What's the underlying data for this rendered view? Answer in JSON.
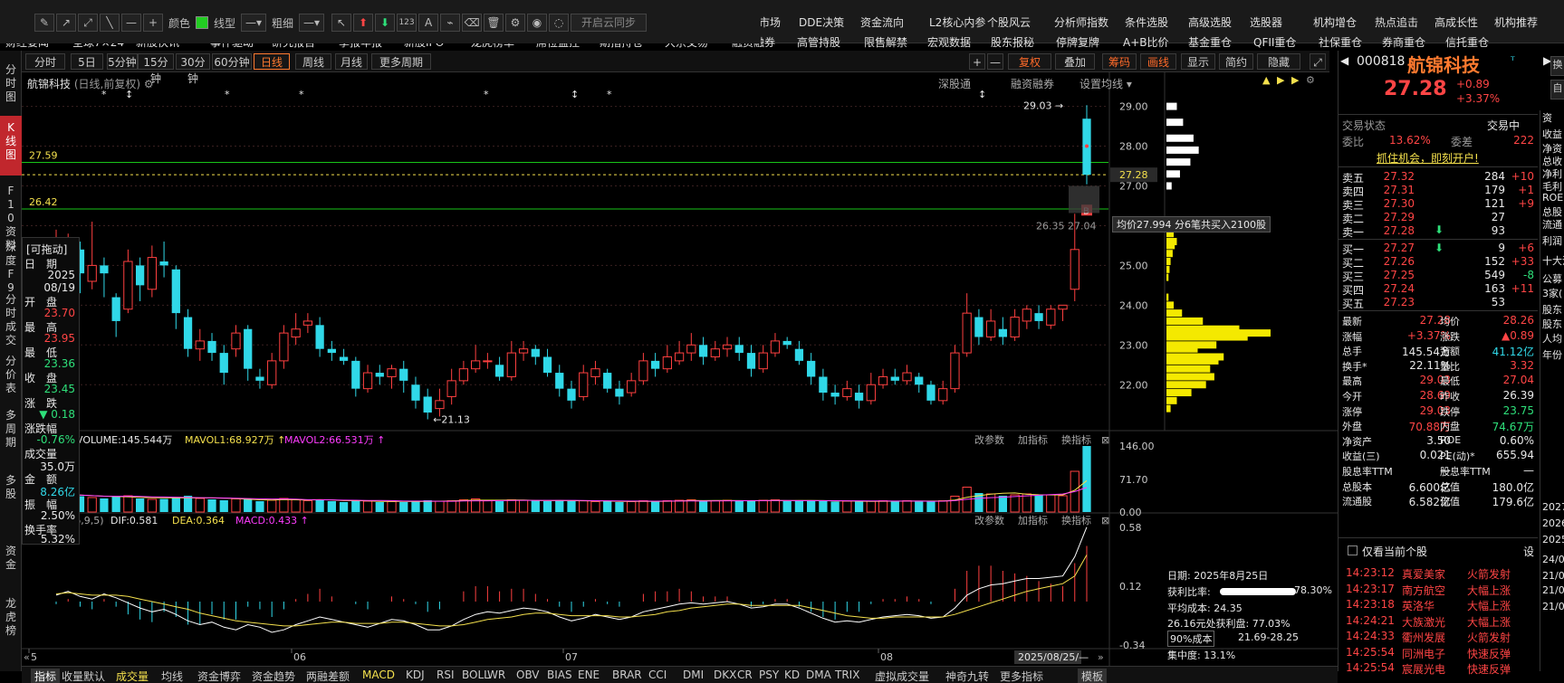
{
  "menu_row1": [
    "全景图",
    "市场",
    "DDE决策",
    "资金流向",
    "L2核心内参",
    "个股风云",
    "分析师指数",
    "条件选股",
    "高级选股",
    "选股器",
    "机构增仓",
    "热点追击",
    "高成长性",
    "机构推荐"
  ],
  "menu_row2": [
    "财经要闻",
    "全球7×24",
    "新股快讯",
    "事件驱动",
    "研究报告",
    "季报年报",
    "新股IPO",
    "龙虎榜单",
    "席位监控",
    "期指持仓",
    "大宗交易",
    "融资融券",
    "高管持股",
    "限售解禁",
    "宏观数据",
    "股东报秘",
    "停牌复牌",
    "A+B比价",
    "基金重仓",
    "QFII重仓",
    "社保重仓",
    "券商重仓",
    "信托重仓"
  ],
  "toolbar": {
    "color_label": "颜色",
    "color_value": "#22cc22",
    "linetype_label": "线型",
    "thickness_label": "粗细",
    "sync_label": "开启云同步",
    "num_label": "123"
  },
  "left_rail": [
    "分时图",
    "K线图",
    "F10资料",
    "深度F9",
    "分时成交",
    "分价表",
    "多周期",
    "多股",
    "资金",
    "龙虎榜"
  ],
  "periods": [
    "分时",
    "5日",
    "5分钟",
    "15分钟",
    "30分钟",
    "60分钟",
    "日线",
    "周线",
    "月线",
    "更多周期"
  ],
  "right_buttons": [
    "+",
    "—",
    "复权",
    "叠加",
    "筹码",
    "画线",
    "显示",
    "简约",
    "隐藏"
  ],
  "chart_title": "航锦科技",
  "chart_subtitle": "(日线,前复权)",
  "top_links": [
    "深股通",
    "融资融券",
    "设置均线"
  ],
  "price_axis": [
    "29.00",
    "28.00",
    "27.00",
    "26.00",
    "25.00",
    "24.00",
    "23.00",
    "22.00"
  ],
  "current_price_tag": "27.28",
  "hline_labels": {
    "upper": "27.59",
    "lower": "26.42"
  },
  "annotations": {
    "high": "29.03",
    "low": "21.13",
    "mid_label": "26.35 27.04"
  },
  "tooltip": "均价27.994 分6笔共买入2100股",
  "infobox": {
    "title": "[可拖动]",
    "date_label": "日　期",
    "date_year": "2025",
    "date_md": "08/19",
    "open_label": "开　盘",
    "open": "23.70",
    "high_label": "最　高",
    "high": "23.95",
    "low_label": "最　低",
    "low": "23.36",
    "close_label": "收　盘",
    "close": "23.45",
    "chg_label": "涨　跌",
    "chg": "▼ 0.18",
    "pct_label": "涨跌幅",
    "pct": "-0.76%",
    "vol_label": "成交量",
    "vol": "35.0万",
    "amt_label": "金　额",
    "amt": "8.26亿",
    "amp_label": "振　幅",
    "amp": "2.50%",
    "turn_label": "换手率",
    "turn": "5.32%"
  },
  "volume": {
    "title": "VOLUME:145.544万",
    "mavol1": "MAVOL1:68.927万",
    "mavol2": "MAVOL2:66.531万",
    "axis": [
      "146.00",
      "71.70",
      "0.00"
    ],
    "links": [
      "改参数",
      "加指标",
      "换指标"
    ]
  },
  "macd": {
    "title": "MACD(26,9,5)",
    "dif": "DIF:0.581",
    "dea": "DEA:0.364",
    "macd": "MACD:0.433",
    "axis": [
      "0.58",
      "0.12",
      "-0.34"
    ],
    "links": [
      "改参数",
      "加指标",
      "换指标"
    ]
  },
  "x_labels": [
    "5",
    "06",
    "07",
    "08",
    "2025/08/25/—"
  ],
  "chip_info": {
    "date": "日期: 2025年8月25日",
    "profit_label": "获利比率:",
    "profit": "78.30%",
    "avg_cost": "平均成本: 24.35",
    "profit_at": "26.16元处获利盘: 77.03%",
    "cost_select": "90%成本",
    "cost_range": "21.69-28.25",
    "concentration": "集中度: 13.1%"
  },
  "bottom_tabs": [
    "指标",
    "收量默认",
    "成交量",
    "均线",
    "资金博弈",
    "资金趋势",
    "两融差额",
    "MACD",
    "KDJ",
    "RSI",
    "BOLL",
    "WR",
    "OBV",
    "BIAS",
    "ENE",
    "BRAR",
    "CCI",
    "DMI",
    "DKX",
    "CR",
    "PSY",
    "KD",
    "DMA",
    "TRIX",
    "虚拟成交量",
    "神奇九转",
    "更多指标",
    "模板"
  ],
  "quote": {
    "code": "000818",
    "name": "航锦科技",
    "price": "27.28",
    "chg": "+0.89",
    "pct": "+3.37%",
    "status_label": "交易状态",
    "status": "交易中",
    "wb_label": "委比",
    "wb": "13.62%",
    "wc_label": "委差",
    "wc": "222",
    "ad": "抓住机会，即刻开户!",
    "asks": [
      {
        "label": "卖五",
        "price": "27.32",
        "vol": "284",
        "delta": "+10"
      },
      {
        "label": "卖四",
        "price": "27.31",
        "vol": "179",
        "delta": "+1"
      },
      {
        "label": "卖三",
        "price": "27.30",
        "vol": "121",
        "delta": "+9"
      },
      {
        "label": "卖二",
        "price": "27.29",
        "vol": "27",
        "delta": ""
      },
      {
        "label": "卖一",
        "price": "27.28",
        "vol": "93",
        "delta": ""
      }
    ],
    "bids": [
      {
        "label": "买一",
        "price": "27.27",
        "vol": "9",
        "delta": "+6"
      },
      {
        "label": "买二",
        "price": "27.26",
        "vol": "152",
        "delta": "+33"
      },
      {
        "label": "买三",
        "price": "27.25",
        "vol": "549",
        "delta": "-8"
      },
      {
        "label": "买四",
        "price": "27.24",
        "vol": "163",
        "delta": "+11"
      },
      {
        "label": "买五",
        "price": "27.23",
        "vol": "53",
        "delta": ""
      }
    ],
    "stats": [
      {
        "l1": "最新",
        "v1": "27.28",
        "c1": "red",
        "l2": "均价",
        "v2": "28.26",
        "c2": "red"
      },
      {
        "l1": "涨幅",
        "v1": "+3.37%",
        "c1": "red",
        "l2": "涨跌",
        "v2": "▲0.89",
        "c2": "red"
      },
      {
        "l1": "总手",
        "v1": "145.54万",
        "c1": "white",
        "l2": "金额",
        "v2": "41.12亿",
        "c2": "cyan"
      },
      {
        "l1": "换手*",
        "v1": "22.11%",
        "c1": "white",
        "l2": "量比",
        "v2": "3.32",
        "c2": "red"
      },
      {
        "l1": "最高",
        "v1": "29.03",
        "c1": "red",
        "l2": "最低",
        "v2": "27.04",
        "c2": "red"
      },
      {
        "l1": "今开",
        "v1": "28.69",
        "c1": "red",
        "l2": "昨收",
        "v2": "26.39",
        "c2": "white"
      },
      {
        "l1": "涨停",
        "v1": "29.03",
        "c1": "red",
        "l2": "跌停",
        "v2": "23.75",
        "c2": "green"
      },
      {
        "l1": "外盘",
        "v1": "70.88万",
        "c1": "red",
        "l2": "内盘",
        "v2": "74.67万",
        "c2": "green"
      },
      {
        "l1": "净资产",
        "v1": "3.50",
        "c1": "white",
        "l2": "ROE",
        "v2": "0.60%",
        "c2": "white"
      },
      {
        "l1": "收益(三)",
        "v1": "0.021",
        "c1": "white",
        "l2": "PE(动)*",
        "v2": "655.94",
        "c2": "white"
      },
      {
        "l1": "股息率TTM",
        "v1": "—",
        "c1": "white",
        "l2": "股息率TTM",
        "v2": "—",
        "c2": "white"
      },
      {
        "l1": "总股本",
        "v1": "6.600亿",
        "c1": "white",
        "l2": "总值",
        "v2": "180.0亿",
        "c2": "white"
      },
      {
        "l1": "流通股",
        "v1": "6.582亿",
        "c1": "white",
        "l2": "流值",
        "v2": "179.6亿",
        "c2": "white"
      }
    ],
    "filter_label": "仅看当前个股",
    "settings_label": "设",
    "news": [
      {
        "time": "14:23:12",
        "name": "真爱美家",
        "event": "火箭发射",
        "c": "red"
      },
      {
        "time": "14:23:17",
        "name": "南方航空",
        "event": "大幅上涨",
        "c": "red"
      },
      {
        "time": "14:23:18",
        "name": "英洛华",
        "event": "大幅上涨",
        "c": "red"
      },
      {
        "time": "14:24:21",
        "name": "大族激光",
        "event": "大幅上涨",
        "c": "red"
      },
      {
        "time": "14:24:33",
        "name": "衢州发展",
        "event": "火箭发射",
        "c": "red"
      },
      {
        "time": "14:25:54",
        "name": "同洲电子",
        "event": "快速反弹",
        "c": "red"
      },
      {
        "time": "14:25:54",
        "name": "宸展光电",
        "event": "快速反弹",
        "c": "red"
      }
    ],
    "edge_labels": [
      "资",
      "收益",
      "净资",
      "总收",
      "净利",
      "毛利",
      "ROE",
      "总股",
      "流通",
      "利润",
      "十大流",
      "公募",
      "3家(",
      "股东",
      "股东",
      "人均",
      "年份",
      "2027",
      "2026",
      "2025",
      "24/0",
      "21/0",
      "21/0",
      "21/0"
    ]
  },
  "chart_data": {
    "type": "candlestick",
    "y_range": [
      20.8,
      29.4
    ],
    "dates_label": [
      "06",
      "07",
      "08"
    ],
    "candles": [
      [
        24.6,
        25.6,
        25.9,
        24.1
      ],
      [
        25.1,
        25.7,
        25.8,
        24.8
      ],
      [
        25.4,
        24.8,
        25.6,
        24.3
      ],
      [
        24.6,
        25.0,
        26.1,
        24.4
      ],
      [
        25.0,
        24.8,
        25.2,
        24.2
      ],
      [
        24.2,
        23.6,
        24.3,
        23.2
      ],
      [
        23.9,
        25.1,
        25.4,
        23.8
      ],
      [
        25.0,
        24.5,
        25.2,
        24.1
      ],
      [
        24.4,
        25.2,
        25.5,
        24.2
      ],
      [
        25.1,
        25.0,
        25.6,
        24.7
      ],
      [
        24.9,
        23.8,
        25.0,
        23.4
      ],
      [
        23.7,
        22.9,
        23.9,
        22.7
      ],
      [
        22.9,
        23.1,
        23.4,
        22.6
      ],
      [
        23.1,
        22.8,
        23.3,
        22.6
      ],
      [
        22.8,
        22.3,
        23.0,
        22.0
      ],
      [
        22.9,
        23.3,
        23.5,
        22.7
      ],
      [
        23.4,
        22.4,
        23.5,
        22.1
      ],
      [
        22.2,
        22.1,
        22.4,
        21.9
      ],
      [
        22.0,
        22.6,
        22.8,
        21.9
      ],
      [
        22.6,
        23.3,
        23.5,
        22.4
      ],
      [
        23.2,
        23.4,
        23.8,
        23.0
      ],
      [
        23.5,
        23.6,
        23.8,
        23.3
      ],
      [
        23.5,
        22.9,
        23.7,
        22.7
      ],
      [
        22.9,
        22.8,
        23.1,
        22.6
      ],
      [
        22.7,
        22.6,
        22.9,
        22.5
      ],
      [
        22.6,
        21.9,
        22.7,
        21.7
      ],
      [
        21.9,
        22.3,
        22.5,
        21.8
      ],
      [
        22.3,
        22.2,
        22.5,
        22.0
      ],
      [
        22.2,
        22.4,
        22.5,
        21.9
      ],
      [
        22.4,
        22.1,
        22.6,
        21.8
      ],
      [
        22.0,
        21.6,
        22.2,
        21.4
      ],
      [
        21.7,
        21.3,
        21.9,
        21.13
      ],
      [
        21.4,
        21.6,
        21.9,
        21.2
      ],
      [
        21.7,
        22.1,
        22.4,
        21.5
      ],
      [
        22.1,
        22.4,
        22.6,
        22.0
      ],
      [
        22.4,
        22.6,
        23.0,
        22.3
      ],
      [
        22.6,
        22.6,
        22.8,
        22.4
      ],
      [
        22.5,
        22.2,
        22.7,
        22.1
      ],
      [
        22.2,
        22.8,
        23.1,
        22.1
      ],
      [
        22.8,
        22.9,
        23.1,
        22.6
      ],
      [
        22.9,
        22.7,
        23.0,
        22.5
      ],
      [
        22.7,
        22.3,
        22.9,
        22.2
      ],
      [
        22.3,
        21.9,
        22.5,
        21.7
      ],
      [
        21.9,
        21.6,
        22.1,
        21.4
      ],
      [
        21.7,
        22.3,
        22.5,
        21.6
      ],
      [
        22.2,
        22.4,
        22.6,
        22.0
      ],
      [
        22.3,
        21.9,
        22.4,
        21.8
      ],
      [
        21.9,
        21.7,
        22.1,
        21.5
      ],
      [
        21.8,
        22.1,
        22.3,
        21.7
      ],
      [
        22.1,
        22.6,
        22.8,
        22.0
      ],
      [
        22.6,
        22.4,
        22.8,
        22.2
      ],
      [
        22.4,
        22.7,
        23.0,
        22.3
      ],
      [
        22.6,
        22.8,
        23.1,
        22.5
      ],
      [
        22.8,
        23.0,
        23.3,
        22.6
      ],
      [
        23.0,
        22.7,
        23.2,
        22.5
      ],
      [
        22.7,
        22.9,
        23.1,
        22.6
      ],
      [
        22.9,
        23.0,
        23.2,
        22.7
      ],
      [
        23.0,
        22.8,
        23.2,
        22.6
      ],
      [
        22.8,
        22.4,
        23.0,
        22.2
      ],
      [
        22.4,
        22.8,
        23.0,
        22.3
      ],
      [
        22.8,
        23.1,
        23.3,
        22.7
      ],
      [
        23.1,
        23.0,
        23.2,
        22.9
      ],
      [
        22.9,
        22.6,
        23.1,
        22.5
      ],
      [
        22.6,
        22.2,
        22.8,
        22.0
      ],
      [
        22.2,
        21.8,
        22.4,
        21.6
      ],
      [
        21.8,
        21.7,
        22.0,
        21.5
      ],
      [
        21.7,
        21.9,
        22.1,
        21.6
      ],
      [
        21.8,
        21.6,
        22.0,
        21.4
      ],
      [
        21.6,
        22.0,
        22.3,
        21.5
      ],
      [
        22.0,
        22.2,
        22.4,
        21.9
      ],
      [
        22.2,
        22.1,
        22.4,
        22.0
      ],
      [
        22.1,
        22.3,
        22.5,
        22.0
      ],
      [
        22.2,
        22.0,
        22.3,
        21.8
      ],
      [
        22.0,
        21.6,
        22.1,
        21.5
      ],
      [
        21.6,
        21.9,
        22.1,
        21.5
      ],
      [
        21.9,
        22.8,
        23.0,
        21.8
      ],
      [
        22.8,
        23.8,
        24.3,
        22.7
      ],
      [
        23.7,
        23.2,
        23.9,
        23.0
      ],
      [
        23.2,
        23.6,
        23.9,
        23.1
      ],
      [
        23.4,
        23.2,
        23.7,
        23.0
      ],
      [
        23.2,
        23.7,
        23.9,
        23.1
      ],
      [
        23.6,
        23.9,
        24.0,
        23.4
      ],
      [
        23.8,
        23.6,
        24.0,
        23.4
      ],
      [
        23.5,
        23.9,
        24.0,
        23.4
      ],
      [
        23.9,
        24.0,
        24.0,
        23.6
      ],
      [
        24.4,
        25.4,
        26.3,
        24.1
      ],
      [
        28.69,
        27.28,
        29.03,
        27.04
      ]
    ],
    "volume": [
      38,
      40,
      35,
      32,
      30,
      34,
      36,
      30,
      28,
      29,
      33,
      36,
      30,
      28,
      26,
      29,
      28,
      24,
      26,
      30,
      27,
      25,
      28,
      24,
      22,
      26,
      24,
      22,
      23,
      22,
      25,
      26,
      24,
      25,
      27,
      29,
      26,
      24,
      27,
      26,
      25,
      24,
      26,
      24,
      25,
      23,
      24,
      22,
      23,
      25,
      24,
      25,
      26,
      27,
      24,
      25,
      26,
      24,
      25,
      26,
      27,
      24,
      25,
      26,
      24,
      23,
      24,
      23,
      24,
      25,
      24,
      25,
      23,
      24,
      25,
      35,
      55,
      42,
      40,
      36,
      38,
      40,
      37,
      38,
      36,
      90,
      146
    ],
    "chip_profile": [
      [
        29.0,
        10
      ],
      [
        28.6,
        16
      ],
      [
        28.2,
        26
      ],
      [
        27.9,
        31
      ],
      [
        27.6,
        23
      ],
      [
        27.3,
        13
      ],
      [
        27.0,
        5
      ],
      [
        26.1,
        3
      ],
      [
        25.9,
        4
      ],
      [
        25.8,
        7
      ],
      [
        25.6,
        10
      ],
      [
        25.5,
        8
      ],
      [
        25.3,
        6
      ],
      [
        25.1,
        4
      ],
      [
        24.9,
        3
      ],
      [
        24.7,
        2
      ],
      [
        24.2,
        2
      ],
      [
        24.0,
        7
      ],
      [
        23.8,
        15
      ],
      [
        23.6,
        35
      ],
      [
        23.4,
        70
      ],
      [
        23.3,
        100
      ],
      [
        23.2,
        78
      ],
      [
        23.0,
        48
      ],
      [
        22.9,
        30
      ],
      [
        22.7,
        55
      ],
      [
        22.6,
        50
      ],
      [
        22.4,
        42
      ],
      [
        22.2,
        46
      ],
      [
        22.0,
        38
      ],
      [
        21.8,
        24
      ],
      [
        21.6,
        10
      ],
      [
        21.4,
        4
      ]
    ],
    "macd_series": {
      "dif": [
        0.05,
        0.08,
        0.04,
        0.02,
        0.06,
        0.03,
        -0.01,
        -0.05,
        -0.08,
        -0.06,
        -0.1,
        -0.15,
        -0.18,
        -0.16,
        -0.2,
        -0.22,
        -0.18,
        -0.2,
        -0.24,
        -0.22,
        -0.18,
        -0.15,
        -0.12,
        -0.14,
        -0.16,
        -0.18,
        -0.2,
        -0.17,
        -0.14,
        -0.15,
        -0.18,
        -0.22,
        -0.22,
        -0.19,
        -0.14,
        -0.1,
        -0.08,
        -0.09,
        -0.07,
        -0.05,
        -0.06,
        -0.08,
        -0.12,
        -0.15,
        -0.13,
        -0.1,
        -0.12,
        -0.14,
        -0.12,
        -0.08,
        -0.06,
        -0.04,
        -0.02,
        -0.01,
        -0.02,
        -0.01,
        0.0,
        -0.02,
        -0.05,
        -0.04,
        -0.02,
        -0.02,
        -0.05,
        -0.09,
        -0.13,
        -0.16,
        -0.15,
        -0.16,
        -0.14,
        -0.12,
        -0.11,
        -0.1,
        -0.11,
        -0.13,
        -0.12,
        -0.05,
        0.05,
        0.1,
        0.13,
        0.14,
        0.16,
        0.18,
        0.18,
        0.19,
        0.2,
        0.35,
        0.581
      ],
      "dea": [
        0.06,
        0.07,
        0.06,
        0.05,
        0.05,
        0.05,
        0.04,
        0.02,
        0.0,
        -0.02,
        -0.04,
        -0.06,
        -0.09,
        -0.11,
        -0.13,
        -0.15,
        -0.16,
        -0.17,
        -0.18,
        -0.19,
        -0.19,
        -0.18,
        -0.17,
        -0.16,
        -0.16,
        -0.17,
        -0.17,
        -0.17,
        -0.16,
        -0.16,
        -0.17,
        -0.18,
        -0.19,
        -0.19,
        -0.18,
        -0.16,
        -0.14,
        -0.13,
        -0.12,
        -0.1,
        -0.09,
        -0.09,
        -0.1,
        -0.11,
        -0.11,
        -0.11,
        -0.11,
        -0.12,
        -0.12,
        -0.11,
        -0.1,
        -0.08,
        -0.07,
        -0.05,
        -0.04,
        -0.03,
        -0.02,
        -0.02,
        -0.03,
        -0.03,
        -0.03,
        -0.03,
        -0.03,
        -0.05,
        -0.07,
        -0.09,
        -0.11,
        -0.12,
        -0.13,
        -0.13,
        -0.12,
        -0.12,
        -0.12,
        -0.12,
        -0.12,
        -0.1,
        -0.07,
        -0.04,
        -0.01,
        0.02,
        0.05,
        0.08,
        0.1,
        0.12,
        0.14,
        0.2,
        0.364
      ]
    }
  }
}
